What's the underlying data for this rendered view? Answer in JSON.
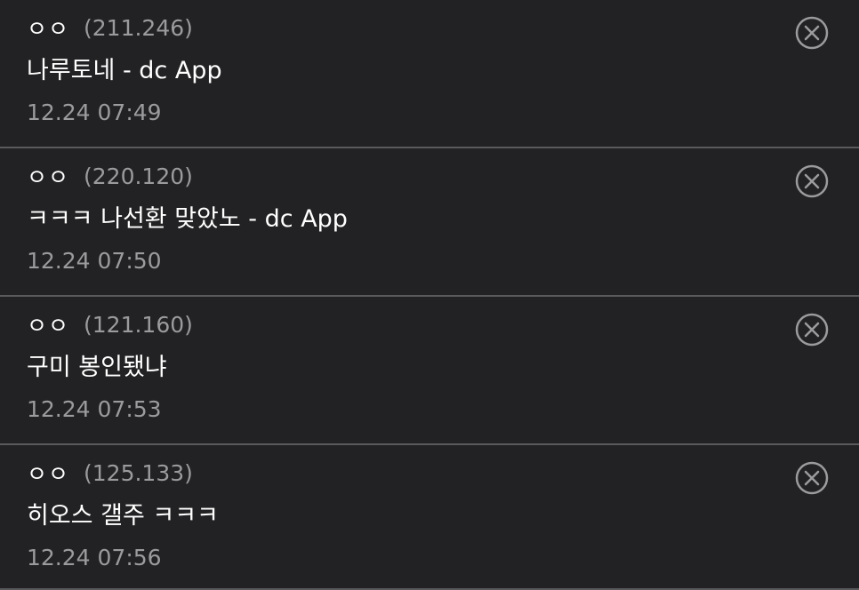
{
  "comments": [
    {
      "nickname": "ㅇㅇ",
      "ip": "(211.246)",
      "text": "나루토네 - dc App",
      "timestamp": "12.24 07:49"
    },
    {
      "nickname": "ㅇㅇ",
      "ip": "(220.120)",
      "text": "ㅋㅋㅋ 나선환 맞았노 - dc App",
      "timestamp": "12.24 07:50"
    },
    {
      "nickname": "ㅇㅇ",
      "ip": "(121.160)",
      "text": "구미 봉인됐냐",
      "timestamp": "12.24 07:53"
    },
    {
      "nickname": "ㅇㅇ",
      "ip": "(125.133)",
      "text": "히오스 갤주 ㅋㅋㅋ",
      "timestamp": "12.24 07:56"
    }
  ],
  "icons": {
    "delete": "close-circle-icon"
  },
  "colors": {
    "background": "#222224",
    "primary_text": "#ffffff",
    "secondary_text": "#9b9b9d",
    "divider": "#5a5a5c",
    "icon": "#9b9b9d"
  }
}
